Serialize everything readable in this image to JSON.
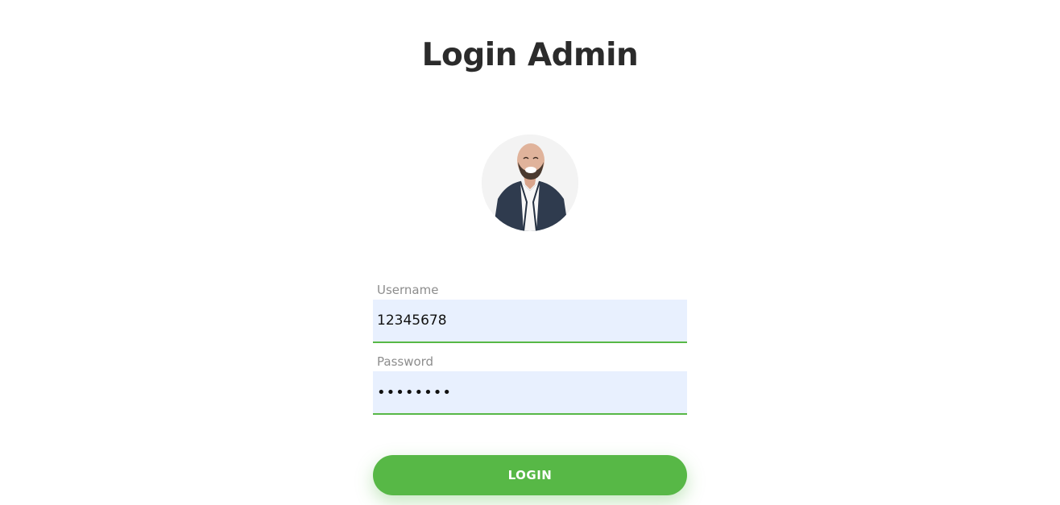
{
  "page": {
    "title": "Login Admin"
  },
  "avatar": {
    "description_icon": "user-photo"
  },
  "form": {
    "username": {
      "label": "Username",
      "value": "12345678"
    },
    "password": {
      "label": "Password",
      "value": "••••••••"
    },
    "login_label": "LOGIN"
  },
  "colors": {
    "accent": "#57b846",
    "input_bg": "#e8f0fe",
    "title": "#2b2b2b",
    "label": "#8d8d8d"
  }
}
